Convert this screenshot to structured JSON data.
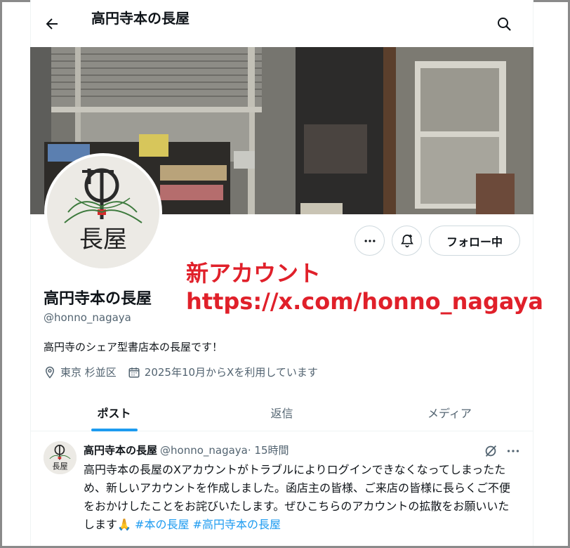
{
  "header": {
    "title": "高円寺本の長屋"
  },
  "profile": {
    "name": "高円寺本の長屋",
    "handle": "@honno_nagaya",
    "bio": "高円寺のシェア型書店本の長屋です！",
    "location": "東京 杉並区",
    "joined": "2025年10月からXを利用しています",
    "follow_label": "フォロー中",
    "avatar_text": "長屋"
  },
  "annotation": {
    "line1": "新アカウント",
    "line2": "https://x.com/honno_nagaya",
    "color": "#e0202a"
  },
  "tabs": [
    {
      "label": "ポスト",
      "active": true
    },
    {
      "label": "返信",
      "active": false
    },
    {
      "label": "メディア",
      "active": false
    }
  ],
  "post": {
    "author": "高円寺本の長屋",
    "handle": "@honno_nagaya",
    "time": "· 15時間",
    "text": "高円寺本の長屋のXアカウントがトラブルによりログインできなくなってしまったため、新しいアカウントを作成しました。函店主の皆様、ご来店の皆様に長らくご不便をおかけしたことをお詫びいたします。ぜひこちらのアカウントの拡散をお願いいたします",
    "emoji": "🙏",
    "hashtag1": "#本の長屋",
    "hashtag2": "#高円寺本の長屋"
  },
  "colors": {
    "accent": "#1d9bf0",
    "muted": "#536471",
    "text": "#0f1419"
  }
}
